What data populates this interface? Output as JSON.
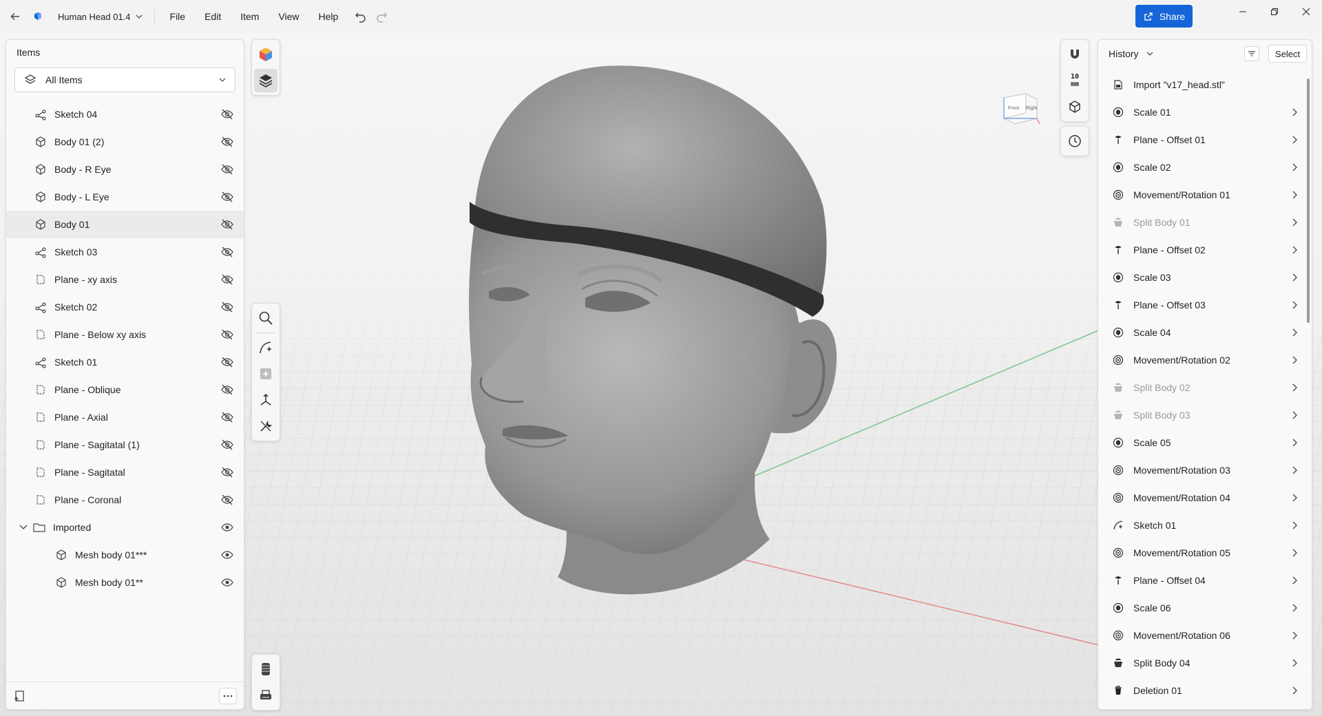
{
  "titlebar": {
    "document_name": "Human Head 01.4",
    "menu": [
      "File",
      "Edit",
      "Item",
      "View",
      "Help"
    ],
    "share_label": "Share",
    "accent_color": "#1565d8"
  },
  "items_panel": {
    "title": "Items",
    "filter_label": "All Items",
    "items": [
      {
        "label": "Sketch 04",
        "icon": "sketch-icon",
        "visible": false
      },
      {
        "label": "Body 01 (2)",
        "icon": "body-icon",
        "visible": false
      },
      {
        "label": "Body - R Eye",
        "icon": "body-icon",
        "visible": false
      },
      {
        "label": "Body - L Eye",
        "icon": "body-icon",
        "visible": false
      },
      {
        "label": "Body 01",
        "icon": "body-icon",
        "visible": false,
        "selected": true
      },
      {
        "label": "Sketch 03",
        "icon": "sketch-icon",
        "visible": false
      },
      {
        "label": "Plane - xy axis",
        "icon": "plane-icon",
        "visible": false
      },
      {
        "label": "Sketch 02",
        "icon": "sketch-icon",
        "visible": false
      },
      {
        "label": "Plane - Below xy axis",
        "icon": "plane-icon",
        "visible": false
      },
      {
        "label": "Sketch 01",
        "icon": "sketch-icon",
        "visible": false
      },
      {
        "label": "Plane - Oblique",
        "icon": "plane-icon",
        "visible": false
      },
      {
        "label": "Plane - Axial",
        "icon": "plane-icon",
        "visible": false
      },
      {
        "label": "Plane - Sagitatal (1)",
        "icon": "plane-icon",
        "visible": false
      },
      {
        "label": "Plane - Sagitatal",
        "icon": "plane-icon",
        "visible": false
      },
      {
        "label": "Plane - Coronal",
        "icon": "plane-icon",
        "visible": false
      },
      {
        "label": "Imported",
        "icon": "folder-icon",
        "visible": true,
        "expanded": true
      },
      {
        "label": "Mesh body 01***",
        "icon": "body-icon",
        "visible": true,
        "child": true
      },
      {
        "label": "Mesh body 01**",
        "icon": "body-icon",
        "visible": true,
        "child": true
      }
    ]
  },
  "right_toolbar": {
    "measure_value": "10",
    "measure_unit": "mm"
  },
  "viewcube": {
    "front_label": "Front",
    "right_label": "Right"
  },
  "history_panel": {
    "title": "History",
    "select_label": "Select",
    "items": [
      {
        "label": "Import \"v17_head.stl\"",
        "icon": "import-icon",
        "disabled": false,
        "chevron": false
      },
      {
        "label": "Scale 01",
        "icon": "scale-icon",
        "disabled": false,
        "chevron": true
      },
      {
        "label": "Plane - Offset 01",
        "icon": "plane-offset-icon",
        "disabled": false,
        "chevron": true
      },
      {
        "label": "Scale 02",
        "icon": "scale-icon",
        "disabled": false,
        "chevron": true
      },
      {
        "label": "Movement/Rotation 01",
        "icon": "movement-icon",
        "disabled": false,
        "chevron": true
      },
      {
        "label": "Split Body 01",
        "icon": "split-body-icon",
        "disabled": true,
        "chevron": true
      },
      {
        "label": "Plane - Offset 02",
        "icon": "plane-offset-icon",
        "disabled": false,
        "chevron": true
      },
      {
        "label": "Scale 03",
        "icon": "scale-icon",
        "disabled": false,
        "chevron": true
      },
      {
        "label": "Plane - Offset 03",
        "icon": "plane-offset-icon",
        "disabled": false,
        "chevron": true
      },
      {
        "label": "Scale 04",
        "icon": "scale-icon",
        "disabled": false,
        "chevron": true
      },
      {
        "label": "Movement/Rotation 02",
        "icon": "movement-icon",
        "disabled": false,
        "chevron": true
      },
      {
        "label": "Split Body 02",
        "icon": "split-body-icon",
        "disabled": true,
        "chevron": true
      },
      {
        "label": "Split Body 03",
        "icon": "split-body-icon",
        "disabled": true,
        "chevron": true
      },
      {
        "label": "Scale 05",
        "icon": "scale-icon",
        "disabled": false,
        "chevron": true
      },
      {
        "label": "Movement/Rotation 03",
        "icon": "movement-icon",
        "disabled": false,
        "chevron": true
      },
      {
        "label": "Movement/Rotation 04",
        "icon": "movement-icon",
        "disabled": false,
        "chevron": true
      },
      {
        "label": "Sketch 01",
        "icon": "sketch-curve-icon",
        "disabled": false,
        "chevron": true
      },
      {
        "label": "Movement/Rotation 05",
        "icon": "movement-icon",
        "disabled": false,
        "chevron": true
      },
      {
        "label": "Plane - Offset 04",
        "icon": "plane-offset-icon",
        "disabled": false,
        "chevron": true
      },
      {
        "label": "Scale 06",
        "icon": "scale-icon",
        "disabled": false,
        "chevron": true
      },
      {
        "label": "Movement/Rotation 06",
        "icon": "movement-icon",
        "disabled": false,
        "chevron": true
      },
      {
        "label": "Split Body 04",
        "icon": "split-body-icon",
        "disabled": false,
        "chevron": true
      },
      {
        "label": "Deletion 01",
        "icon": "trash-icon",
        "disabled": false,
        "chevron": true
      }
    ]
  }
}
